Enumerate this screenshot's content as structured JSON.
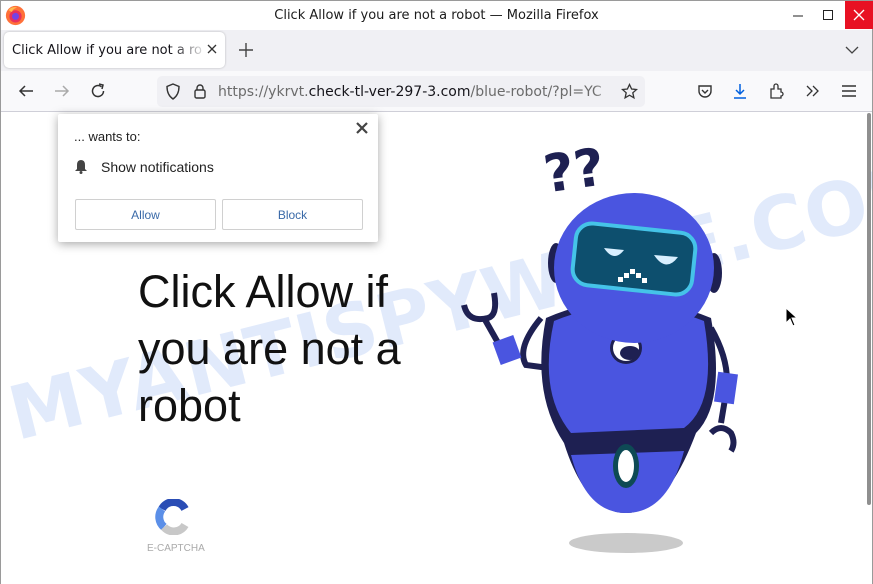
{
  "window": {
    "title": "Click Allow if you are not a robot — Mozilla Firefox",
    "controls": [
      "minimize",
      "maximize",
      "close"
    ],
    "close_color": "#e81123"
  },
  "tabs": [
    {
      "title": "Click Allow if you are not a robot",
      "active": true
    }
  ],
  "navbar": {
    "url_scheme": "https://ykrvt.",
    "url_domain": "check-tl-ver-297-3.com",
    "url_path": "/blue-robot/?pl=YC",
    "icons": [
      "back-icon",
      "forward-icon",
      "reload-icon",
      "shield-icon",
      "lock-icon",
      "bookmark-star-icon",
      "pocket-icon",
      "download-icon",
      "extensions-icon",
      "overflow-icon",
      "menu-icon"
    ],
    "download_color": "#0060df"
  },
  "popup": {
    "wants": "... wants to:",
    "permission": "Show notifications",
    "allow_label": "Allow",
    "block_label": "Block"
  },
  "page": {
    "headline": "Click Allow if you are not a robot",
    "captcha_label": "E-CAPTCHA",
    "watermark": "MYANTISPYWARE.COM",
    "robot_color": "#4a55e0",
    "robot_dark": "#1e2052"
  }
}
